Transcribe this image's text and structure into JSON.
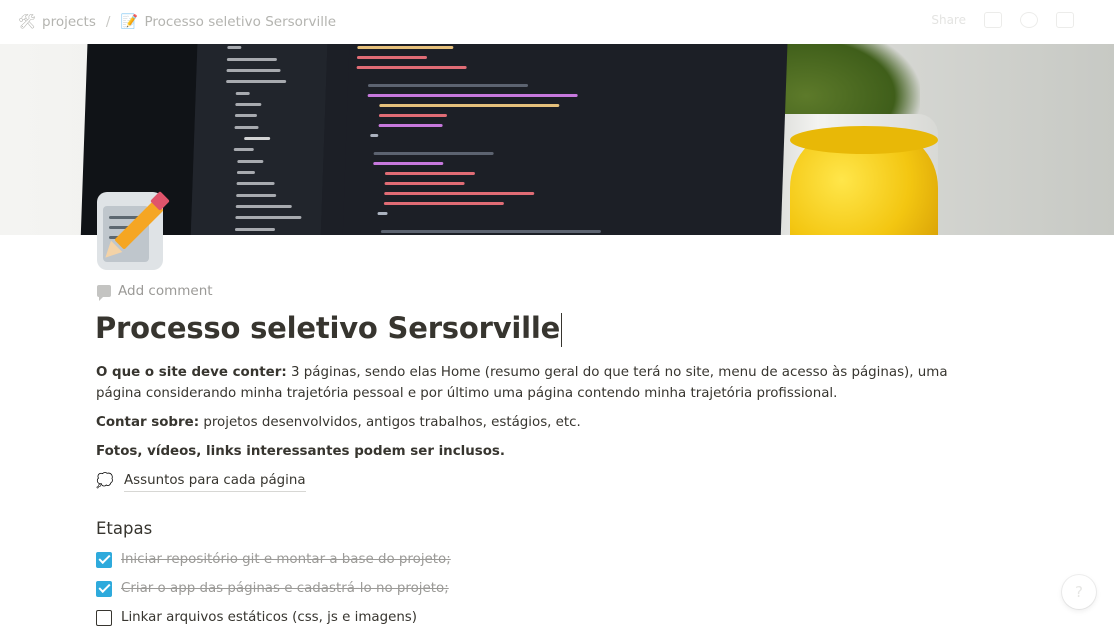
{
  "breadcrumb": {
    "workspace": {
      "label": "projects",
      "icon": "tools-icon"
    },
    "separator": "/",
    "page": {
      "label": "Processo seletivo Sersorville",
      "icon": "memo-icon"
    }
  },
  "topbar": {
    "share_label": "Share"
  },
  "page": {
    "add_comment": "Add comment",
    "title": "Processo seletivo Sersorville",
    "paragraphs": [
      {
        "bold": "O que o site deve conter:",
        "text": " 3 páginas, sendo elas Home (resumo geral do que terá no site, menu de acesso às páginas), uma página considerando minha trajetória pessoal e por último uma página contendo minha trajetória profissional."
      },
      {
        "bold": "Contar sobre:",
        "text": " projetos desenvolvidos, antigos trabalhos, estágios, etc."
      },
      {
        "bold": "Fotos, vídeos, links interessantes podem ser inclusos.",
        "text": ""
      }
    ],
    "link_page": {
      "label": "Assuntos para cada página",
      "icon": "thought-balloon-icon"
    },
    "heading": "Etapas",
    "todos": [
      {
        "label": "Iniciar repositório git e montar a base do projeto;",
        "checked": true
      },
      {
        "label": "Criar o app das páginas e cadastrá-lo no projeto;",
        "checked": true
      },
      {
        "label": "Linkar arquivos estáticos (css, js e imagens)",
        "checked": false
      }
    ]
  },
  "help_button": "?",
  "colors": {
    "text": "#37352f",
    "muted": "#9b9a97",
    "checkbox_checked": "#2eaadc"
  }
}
